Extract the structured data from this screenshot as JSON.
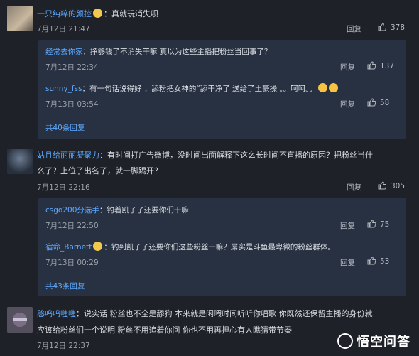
{
  "comments": [
    {
      "user": "一只纯粹的颜控",
      "text": "：真就玩消失呗",
      "date": "7月12日 21:47",
      "reply_label": "回复",
      "likes": "378",
      "replies": [
        {
          "user": "经常去你家",
          "text": "：挣够钱了不消失干嘛 真以为这些主播把粉丝当回事了？",
          "date": "7月12日 22:34",
          "reply_label": "回复",
          "likes": "137"
        },
        {
          "user": "sunny_fss",
          "text": "：有一句话说得好 ，舔粉把女神的“舔干净了 送给了土豪操 。。呵呵。。",
          "date": "7月13日 03:54",
          "reply_label": "回复",
          "likes": "58"
        }
      ],
      "more_replies": "共40条回复"
    },
    {
      "user": "姑且给丽丽凝聚力",
      "text_line1": "：有时间打广告微博，没时间出面解释下这么长时间不直播的原因？把粉丝当什",
      "text_line2": "么了？上位了出名了，就一脚踢开？",
      "date": "7月12日 22:16",
      "reply_label": "回复",
      "likes": "305",
      "replies": [
        {
          "user": "csgo200分选手",
          "text": "：钓着凯子了还要你们干嘛",
          "date": "7月12日 22:50",
          "reply_label": "回复",
          "likes": "75"
        },
        {
          "user": "宿命_Barnett",
          "text": "：钓到凯子了还要你们这些粉丝干嘛？屌实是斗鱼最卑微的粉丝群体。",
          "date": "7月13日 00:29",
          "reply_label": "回复",
          "likes": "53"
        }
      ],
      "more_replies": "共43条回复"
    },
    {
      "user": "憨呜呜嗤嗤",
      "text_line1": "：说实话 粉丝也不全是舔狗 本来就是闲暇时间听听你唱歌 你既然还保留主播的身份就",
      "text_line2": "应该给粉丝们一个说明 粉丝不用追着你问 你也不用再担心有人瞧猜带节奏",
      "date": "7月12日 22:37"
    }
  ],
  "watermark": "悟空问答",
  "colors": {
    "background": "#1e2127",
    "nested_background": "#283141",
    "link": "#5fa9ff"
  }
}
